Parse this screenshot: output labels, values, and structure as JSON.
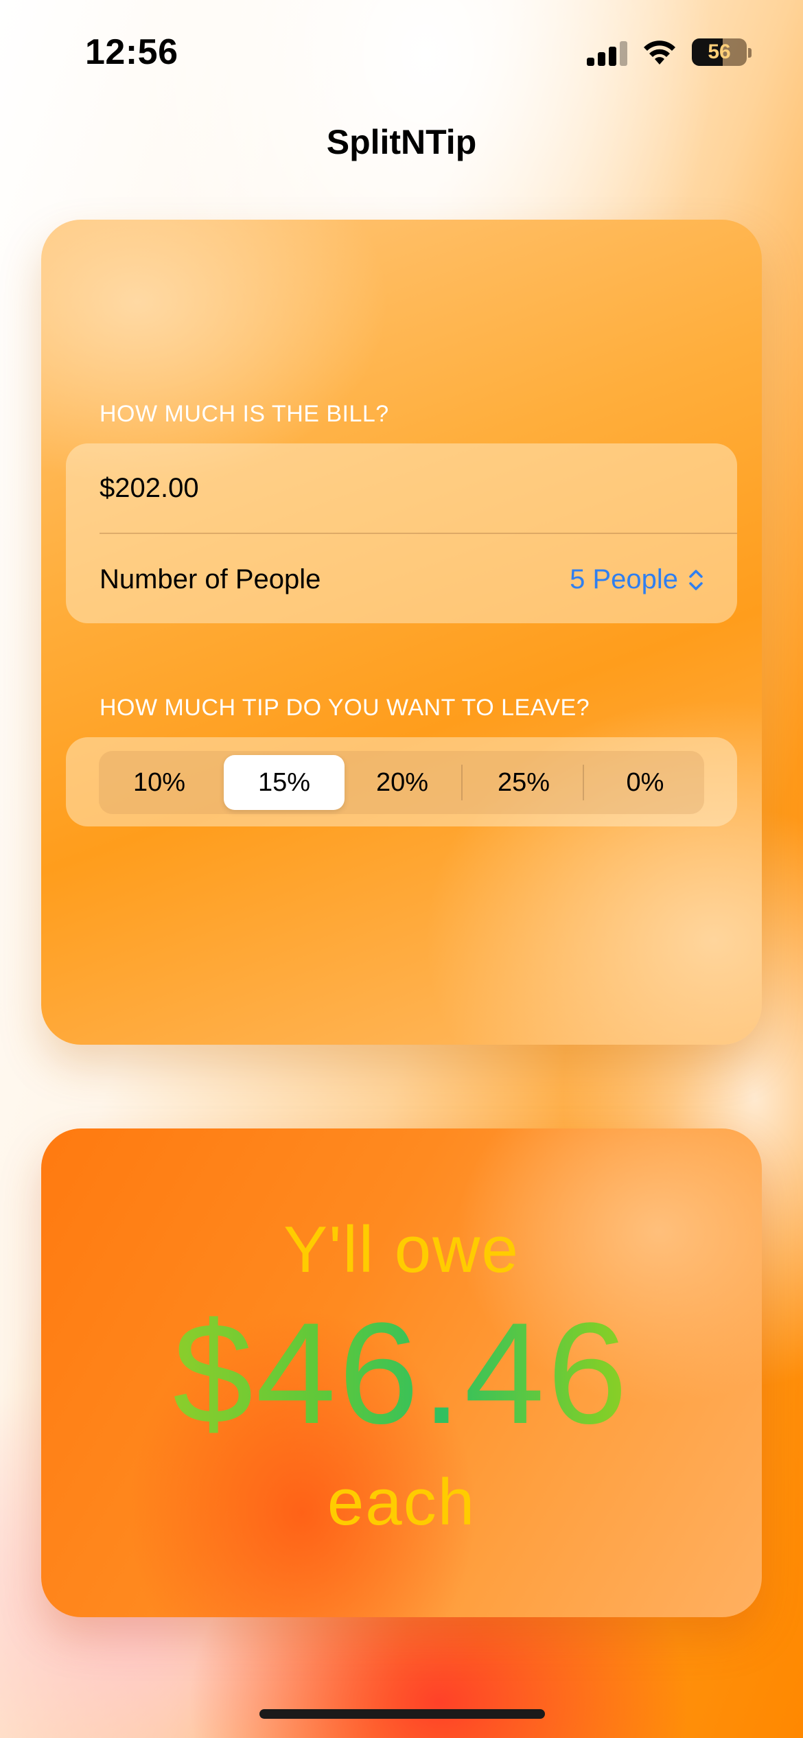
{
  "status_bar": {
    "time": "12:56",
    "battery_level": "56",
    "signal_bars": 3,
    "signal_bars_total": 4
  },
  "nav": {
    "title": "SplitNTip"
  },
  "bill_section": {
    "header": "HOW MUCH IS THE BILL?",
    "bill_value": "$202.00",
    "people_label": "Number of People",
    "people_value": "5 People"
  },
  "tip_section": {
    "header": "HOW MUCH TIP DO YOU WANT TO LEAVE?",
    "options": [
      "10%",
      "15%",
      "20%",
      "25%",
      "0%"
    ],
    "selected": "15%"
  },
  "result": {
    "owe_label": "Y'll owe",
    "amount": "$46.46",
    "each_label": "each"
  },
  "colors": {
    "accent_blue": "#2f7ff0",
    "result_text_yellow": "#ffcc00",
    "amount_gradient_green": "#30c060"
  },
  "icons": [
    "signal-icon",
    "wifi-icon",
    "battery-icon",
    "chevron-updown-icon"
  ]
}
